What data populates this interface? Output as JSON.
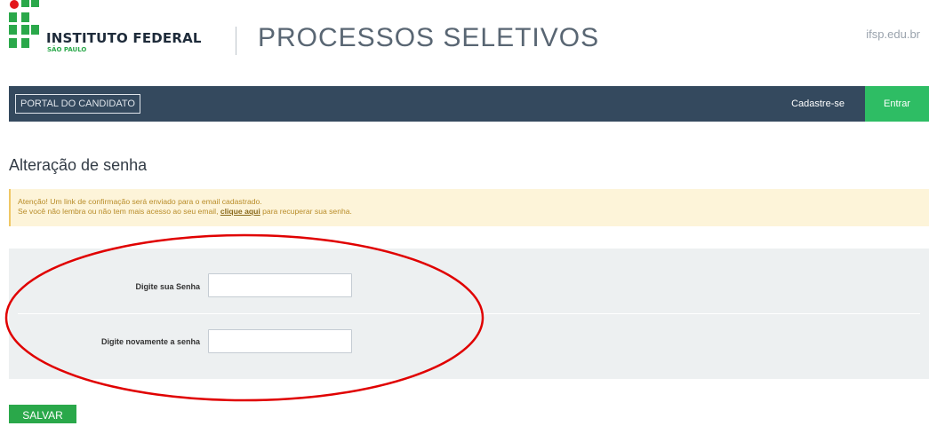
{
  "header": {
    "logo_title": "INSTITUTO FEDERAL",
    "logo_subtitle": "SÃO PAULO",
    "site_title": "PROCESSOS SELETIVOS",
    "domain": "ifsp.edu.br"
  },
  "navbar": {
    "brand": "PORTAL DO CANDIDATO",
    "register": "Cadastre-se",
    "login": "Entrar"
  },
  "page": {
    "title": "Alteração de senha"
  },
  "alert": {
    "line1": "Atenção! Um link de confirmação será enviado para o email cadastrado.",
    "line2_prefix": "Se você não lembra ou não tem mais acesso ao seu email, ",
    "link_text": "clique aqui",
    "line2_suffix": " para recuperar sua senha."
  },
  "form": {
    "password_label": "Digite sua Senha",
    "password_value": "",
    "confirm_label": "Digite novamente a senha",
    "confirm_value": "",
    "save_label": "SALVAR"
  },
  "colors": {
    "navbar": "#34495e",
    "accent_green": "#2ebd64",
    "logo_red": "#e3171b",
    "alert_bg": "#fdf4d9",
    "annotation": "#e00000"
  }
}
